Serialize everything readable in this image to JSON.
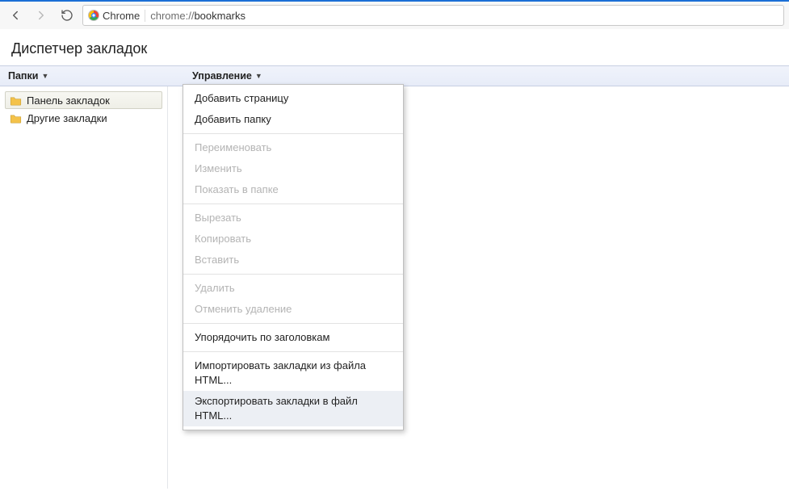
{
  "browser": {
    "origin_label": "Chrome",
    "url_host": "chrome://",
    "url_path": "bookmarks"
  },
  "page": {
    "title": "Диспетчер закладок"
  },
  "columns": {
    "folders_label": "Папки",
    "manage_label": "Управление"
  },
  "sidebar": {
    "items": [
      {
        "label": "Панель закладок",
        "selected": true
      },
      {
        "label": "Другие закладки",
        "selected": false
      }
    ]
  },
  "menu": {
    "groups": [
      [
        {
          "label": "Добавить страницу",
          "enabled": true
        },
        {
          "label": "Добавить папку",
          "enabled": true
        }
      ],
      [
        {
          "label": "Переименовать",
          "enabled": false
        },
        {
          "label": "Изменить",
          "enabled": false
        },
        {
          "label": "Показать в папке",
          "enabled": false
        }
      ],
      [
        {
          "label": "Вырезать",
          "enabled": false
        },
        {
          "label": "Копировать",
          "enabled": false
        },
        {
          "label": "Вставить",
          "enabled": false
        }
      ],
      [
        {
          "label": "Удалить",
          "enabled": false
        },
        {
          "label": "Отменить удаление",
          "enabled": false
        }
      ],
      [
        {
          "label": "Упорядочить по заголовкам",
          "enabled": true
        }
      ],
      [
        {
          "label": "Импортировать закладки из файла HTML...",
          "enabled": true
        },
        {
          "label": "Экспортировать закладки в файл HTML...",
          "enabled": true,
          "hover": true
        }
      ]
    ]
  }
}
